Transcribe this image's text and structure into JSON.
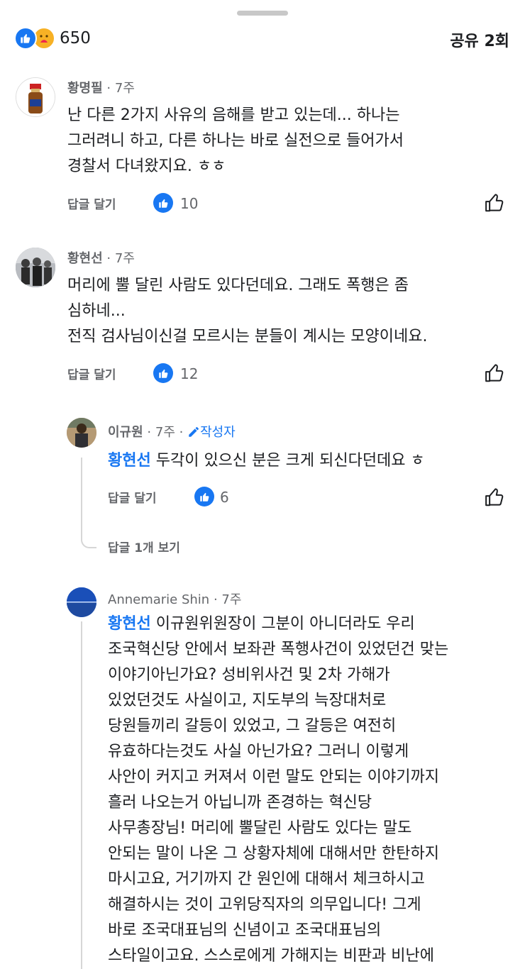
{
  "reactions": {
    "count": "650",
    "icons": [
      "like-icon",
      "care-icon"
    ]
  },
  "share_label": "공유 2회",
  "comments": [
    {
      "author": "황명필",
      "time": "· 7주",
      "lines": [
        "난 다른 2가지 사유의 음해를 받고 있는데... 하나는",
        "그러려니 하고, 다른 하나는 바로 실전으로 들어가서",
        "경찰서 다녀왔지요. ㅎㅎ"
      ],
      "reply_label": "답글 달기",
      "likes": "10"
    },
    {
      "author": "황현선",
      "time": "· 7주",
      "lines": [
        "머리에 뿔 달린 사람도 있다던데요. 그래도 폭행은 좀",
        "심하네...",
        "전직 검사님이신걸 모르시는 분들이 계시는 모양이네요."
      ],
      "reply_label": "답글 달기",
      "likes": "12"
    },
    {
      "author": "이규원",
      "time": "· 7주 ·",
      "badge": "작성자",
      "mention": "황현선",
      "text": " 두각이 있으신 분은 크게 되신다던데요 ㅎ",
      "reply_label": "답글 달기",
      "likes": "6",
      "more_replies": "답글 1개 보기"
    },
    {
      "author": "Annemarie Shin",
      "time": "· 7주",
      "mention": "황현선",
      "first_line": " 이규원위원장이 그분이 아니더라도 우리",
      "lines": [
        "조국혁신당 안에서 보좌관 폭행사건이 있었던건 맞는",
        "이야기아닌가요? 성비위사건 및 2차 가해가",
        "있었던것도 사실이고, 지도부의 늑장대처로",
        "당원들끼리 갈등이 있었고, 그 갈등은 여전히",
        "유효하다는것도 사실 아닌가요? 그러니 이렇게",
        "사안이 커지고 커져서 이런 말도 안되는 이야기까지",
        "흘러 나오는거 아닙니까 존경하는 혁신당",
        "사무총장님! 머리에 뿔달린 사람도 있다는 말도",
        "안되는 말이 나온 그 상황자체에 대해서만 한탄하지",
        "마시고요, 거기까지 간 원인에 대해서 체크하시고",
        "해결하시는 것이 고위당직자의 의무입니다! 그게",
        "바로 조국대표님의 신념이고 조국대표님의",
        "스타일이고요. 스스로에게 가해지는 비판과 비난에"
      ]
    }
  ]
}
